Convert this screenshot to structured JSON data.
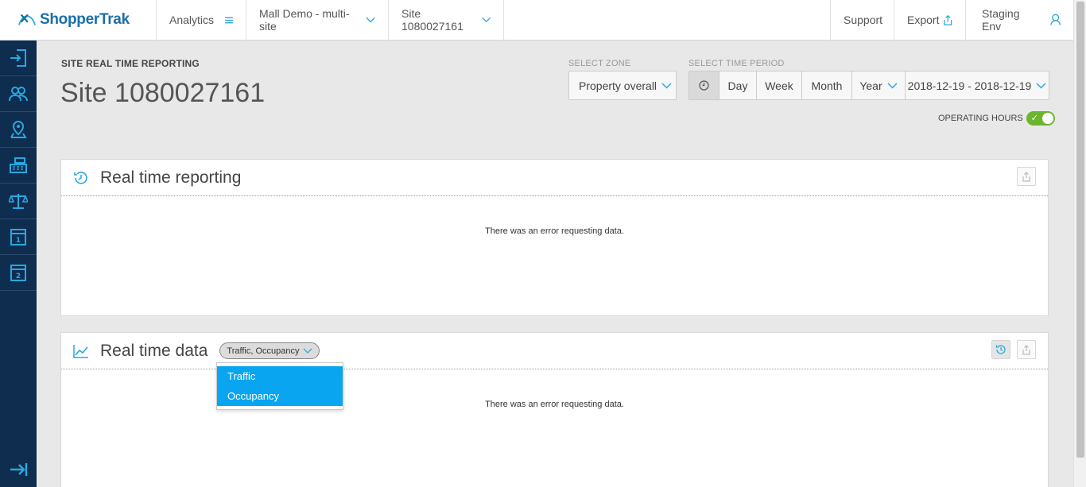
{
  "brand": {
    "name": "ShopperTrak",
    "color": "#1b6fa8"
  },
  "topnav": {
    "analytics_label": "Analytics",
    "org_label": "Mall Demo - multi-site",
    "site_label": "Site 1080027161",
    "support_label": "Support",
    "export_label": "Export",
    "env_label": "Staging Env"
  },
  "sidebar": {
    "items": [
      {
        "icon": "login-icon"
      },
      {
        "icon": "users-icon"
      },
      {
        "icon": "map-pin-icon"
      },
      {
        "icon": "cash-register-icon"
      },
      {
        "icon": "balance-scale-icon"
      },
      {
        "icon": "calendar-1-icon",
        "label": "1"
      },
      {
        "icon": "calendar-2-icon",
        "label": "2"
      }
    ],
    "bottom_icon": "expand-arrow-icon"
  },
  "header": {
    "kicker": "SITE REAL TIME REPORTING",
    "title": "Site 1080027161"
  },
  "zone": {
    "label": "SELECT ZONE",
    "value": "Property overall"
  },
  "period": {
    "label": "SELECT TIME PERIOD",
    "day": "Day",
    "week": "Week",
    "month": "Month",
    "year": "Year",
    "range": "2018-12-19 - 2018-12-19"
  },
  "operating_hours": {
    "label": "OPERATING HOURS",
    "enabled": true,
    "color": "#6cb52f"
  },
  "panel_reporting": {
    "title": "Real time reporting",
    "message": "There was an error requesting data."
  },
  "panel_data": {
    "title": "Real time data",
    "metric_select": "Traffic, Occupancy",
    "message": "There was an error requesting data.",
    "dropdown_options": [
      "Traffic",
      "Occupancy"
    ]
  },
  "colors": {
    "accent": "#0aa5f0",
    "sidebar_bg": "#0f2d4f",
    "icon_blue": "#29a8e0"
  }
}
